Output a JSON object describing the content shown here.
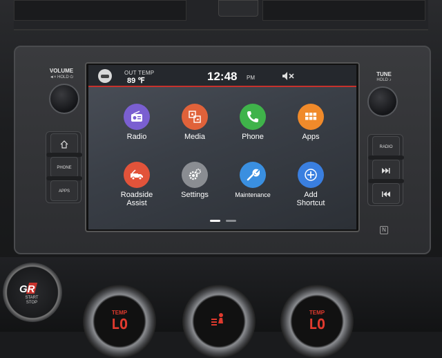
{
  "status_bar": {
    "out_temp_label": "OUT TEMP",
    "out_temp_value": "89 ℉",
    "clock": "12:48",
    "ampm": "PM"
  },
  "apps": [
    {
      "label": "Radio",
      "color": "#7a5fd1",
      "icon": "radio-icon"
    },
    {
      "label": "Media",
      "color": "#e0623a",
      "icon": "media-icon"
    },
    {
      "label": "Phone",
      "color": "#3fb34a",
      "icon": "phone-icon"
    },
    {
      "label": "Apps",
      "color": "#f08a2a",
      "icon": "apps-grid-icon"
    },
    {
      "label": "Roadside\nAssist",
      "color": "#e2533a",
      "icon": "tow-truck-icon"
    },
    {
      "label": "Settings",
      "color": "#8a8d92",
      "icon": "gear-icon"
    },
    {
      "label": "Maintenance",
      "color": "#3a8fe0",
      "icon": "wrench-icon"
    },
    {
      "label": "Add\nShortcut",
      "color": "#3a7fe0",
      "icon": "add-icon"
    }
  ],
  "left_controls": {
    "volume_label": "VOLUME",
    "volume_hint": "◄× HOLD ⏻",
    "buttons": [
      "",
      "PHONE",
      "APPS"
    ]
  },
  "right_controls": {
    "tune_label": "TUNE",
    "tune_hint": "HOLD ♪",
    "buttons": [
      "RADIO",
      "",
      ""
    ]
  },
  "start_button": {
    "logo": "GR",
    "text": "START\nSTOP"
  },
  "climate": [
    {
      "label": "TEMP",
      "value": "LO"
    },
    {
      "label": "",
      "value": ""
    },
    {
      "label": "TEMP",
      "value": "LO"
    }
  ],
  "colors": {
    "accent_red": "#c8322c",
    "climate_red": "#e03a2e"
  }
}
